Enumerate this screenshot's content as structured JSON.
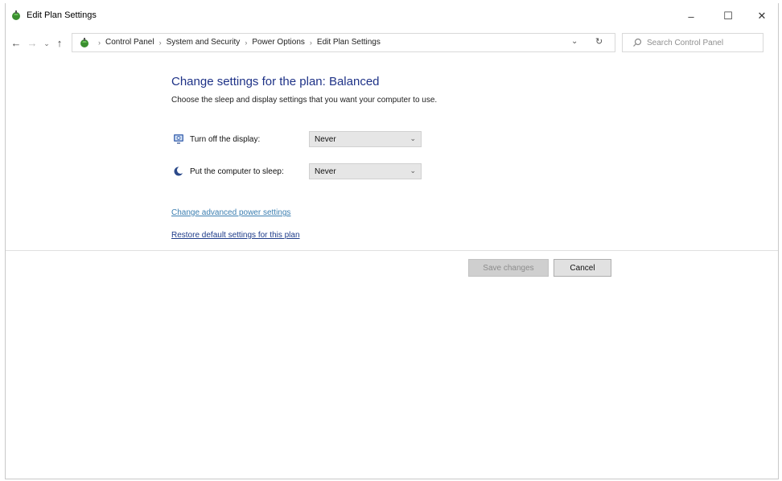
{
  "window": {
    "title": "Edit Plan Settings",
    "controls": {
      "minimize": "–",
      "maximize": "☐",
      "close": "✕"
    }
  },
  "nav": {
    "back": "←",
    "forward": "→",
    "recent": "⌄",
    "up": "↑",
    "breadcrumbs": [
      "Control Panel",
      "System and Security",
      "Power Options",
      "Edit Plan Settings"
    ],
    "separator": "›",
    "dropdown": "⌄",
    "refresh": "↻",
    "search_placeholder": "Search Control Panel"
  },
  "content": {
    "heading": "Change settings for the plan: Balanced",
    "subtitle": "Choose the sleep and display settings that you want your computer to use.",
    "settings": [
      {
        "label": "Turn off the display:",
        "value": "Never",
        "icon": "monitor-icon"
      },
      {
        "label": "Put the computer to sleep:",
        "value": "Never",
        "icon": "moon-icon"
      }
    ],
    "links": {
      "advanced": "Change advanced power settings",
      "restore": "Restore default settings for this plan"
    }
  },
  "buttons": {
    "save": "Save changes",
    "cancel": "Cancel"
  },
  "colors": {
    "heading": "#1e3287",
    "link_advanced": "#3c7fb1",
    "link_restore": "#1e3c8a",
    "dropdown_bg": "#e6e6e6"
  }
}
